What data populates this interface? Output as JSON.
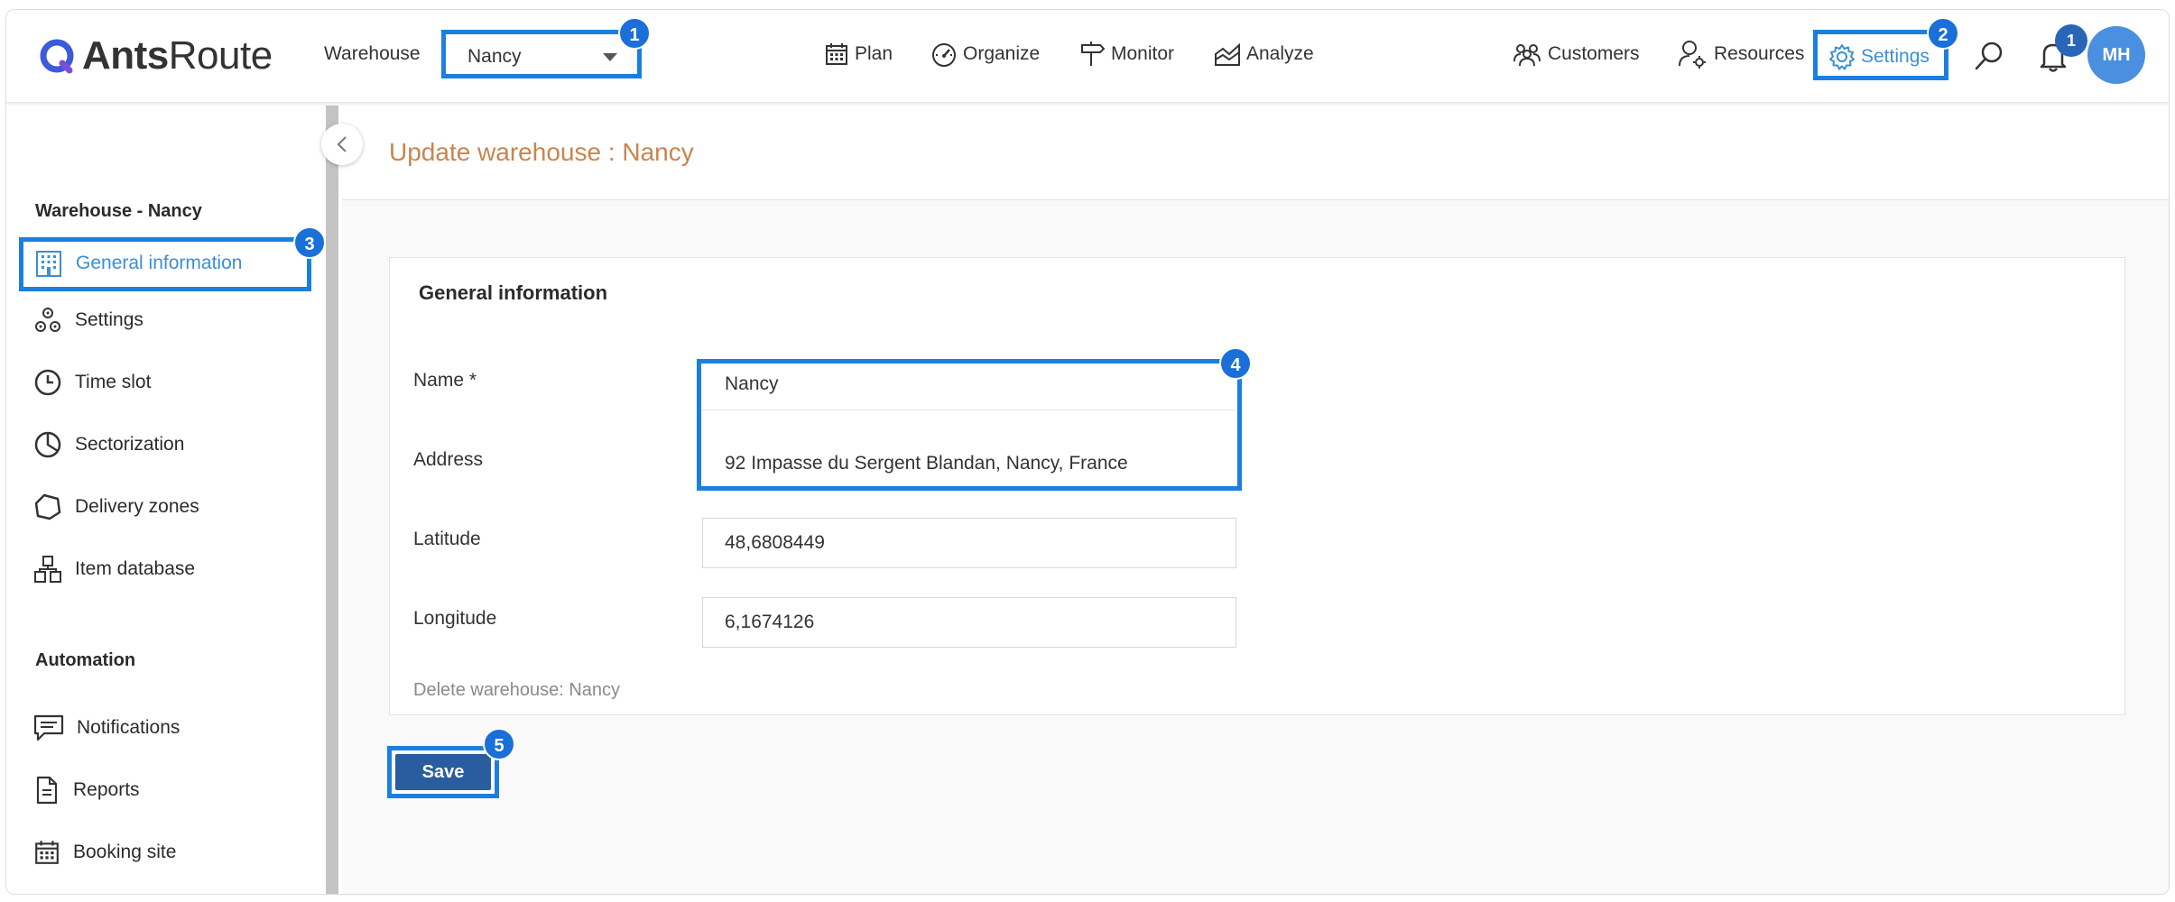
{
  "header": {
    "logo": {
      "brand_bold": "Ants",
      "brand_light": "Route"
    },
    "warehouse_label": "Warehouse",
    "warehouse_selected": "Nancy",
    "nav": [
      {
        "label": "Plan",
        "icon": "calendar-icon"
      },
      {
        "label": "Organize",
        "icon": "speedometer-icon"
      },
      {
        "label": "Monitor",
        "icon": "signpost-icon"
      },
      {
        "label": "Analyze",
        "icon": "area-chart-icon"
      }
    ],
    "right": {
      "customers": "Customers",
      "resources": "Resources",
      "settings": "Settings"
    },
    "notification_count": "1",
    "avatar_initials": "MH"
  },
  "callouts": [
    "1",
    "2",
    "3",
    "4",
    "5"
  ],
  "sidebar": {
    "section1_title": "Warehouse - Nancy",
    "items": [
      {
        "label": "General information",
        "icon": "building-icon"
      },
      {
        "label": "Settings",
        "icon": "cogs-icon"
      },
      {
        "label": "Time slot",
        "icon": "clock-icon"
      },
      {
        "label": "Sectorization",
        "icon": "pie-icon"
      },
      {
        "label": "Delivery zones",
        "icon": "polygon-icon"
      },
      {
        "label": "Item database",
        "icon": "boxes-icon"
      }
    ],
    "section2_title": "Automation",
    "automation_items": [
      {
        "label": "Notifications",
        "icon": "message-icon"
      },
      {
        "label": "Reports",
        "icon": "document-icon"
      },
      {
        "label": "Booking site",
        "icon": "calendar-icon"
      }
    ]
  },
  "main": {
    "page_title": "Update warehouse : Nancy",
    "card_title": "General information",
    "fields": [
      {
        "label": "Name *",
        "value": "Nancy"
      },
      {
        "label": "Address",
        "value": "92 Impasse du Sergent Blandan, Nancy, France"
      },
      {
        "label": "Latitude",
        "value": "48,6808449"
      },
      {
        "label": "Longitude",
        "value": "6,1674126"
      }
    ],
    "delete_link": "Delete warehouse: Nancy",
    "save_label": "Save"
  },
  "colors": {
    "accent": "#1a7fe0",
    "link_active": "#3a8fd6",
    "title_orange": "#c8854f",
    "save_button": "#2a5d9f"
  }
}
